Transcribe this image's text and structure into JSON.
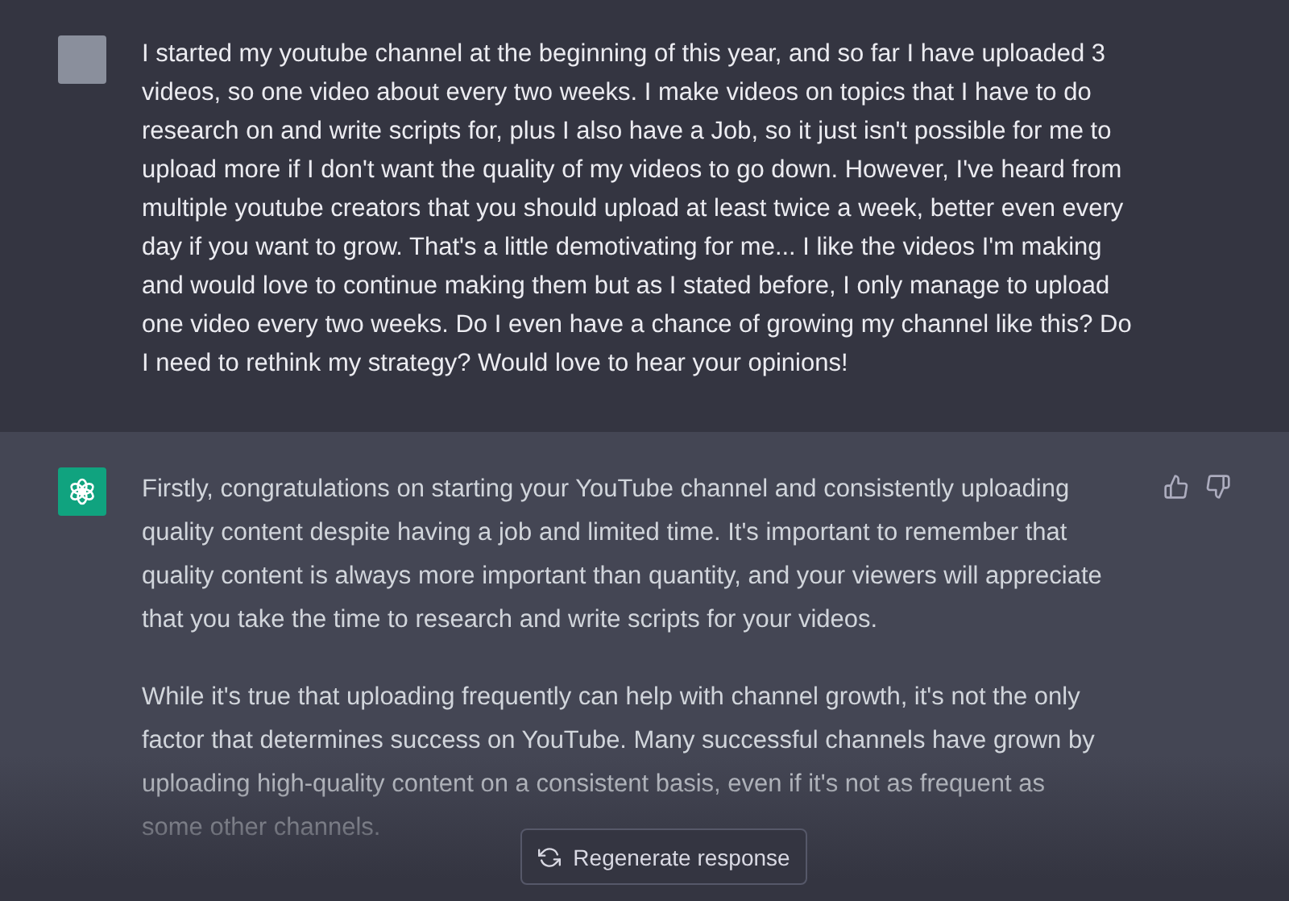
{
  "conversation": [
    {
      "kind": "user",
      "text": "I started my youtube channel at the beginning of this year, and so far I have uploaded 3 videos, so one video about every two weeks. I make videos on topics that I have to do research on and write scripts for, plus I also have a Job, so it just isn't possible for me to upload more if I don't want the quality of my videos to go down. However, I've heard from multiple youtube creators that you should upload at least twice a week, better even every day if you want to grow. That's a little demotivating for me... I like the videos I'm making and would love to continue making them but as I stated before, I only manage to upload one video every two weeks. Do I even have a chance of growing my channel like this? Do I need to rethink my strategy? Would love to hear your opinions!"
    },
    {
      "kind": "assistant",
      "paragraphs": [
        "Firstly, congratulations on starting your YouTube channel and consistently uploading quality content despite having a job and limited time. It's important to remember that quality content is always more important than quantity, and your viewers will appreciate that you take the time to research and write scripts for your videos.",
        "While it's true that uploading frequently can help with channel growth, it's not the only factor that determines success on YouTube. Many successful channels have grown by uploading high-quality content on a consistent basis, even if it's not as frequent as some other channels."
      ]
    }
  ],
  "regenerate_button": "Regenerate response"
}
